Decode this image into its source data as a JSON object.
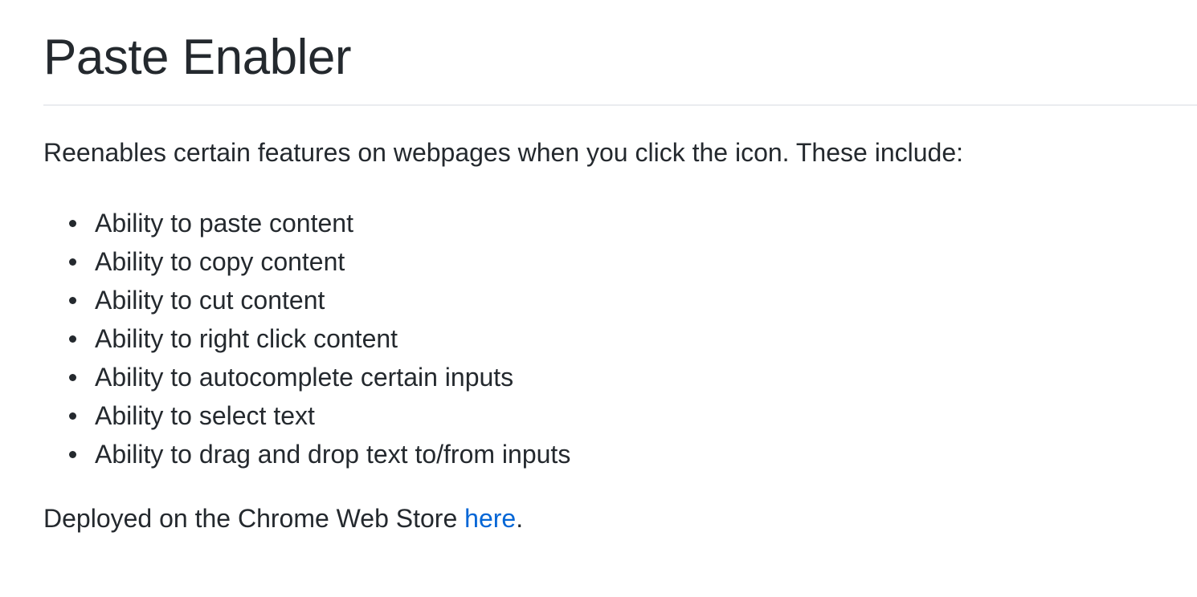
{
  "readme": {
    "title": "Paste Enabler",
    "intro": "Reenables certain features on webpages when you click the icon. These include:",
    "features": [
      "Ability to paste content",
      "Ability to copy content",
      "Ability to cut content",
      "Ability to right click content",
      "Ability to autocomplete certain inputs",
      "Ability to select text",
      "Ability to drag and drop text to/from inputs"
    ],
    "deploy_prefix": "Deployed on the Chrome Web Store ",
    "deploy_link": "here",
    "deploy_suffix": "."
  },
  "colors": {
    "text": "#24292e",
    "link": "#0366d6",
    "divider": "#eaecef"
  }
}
